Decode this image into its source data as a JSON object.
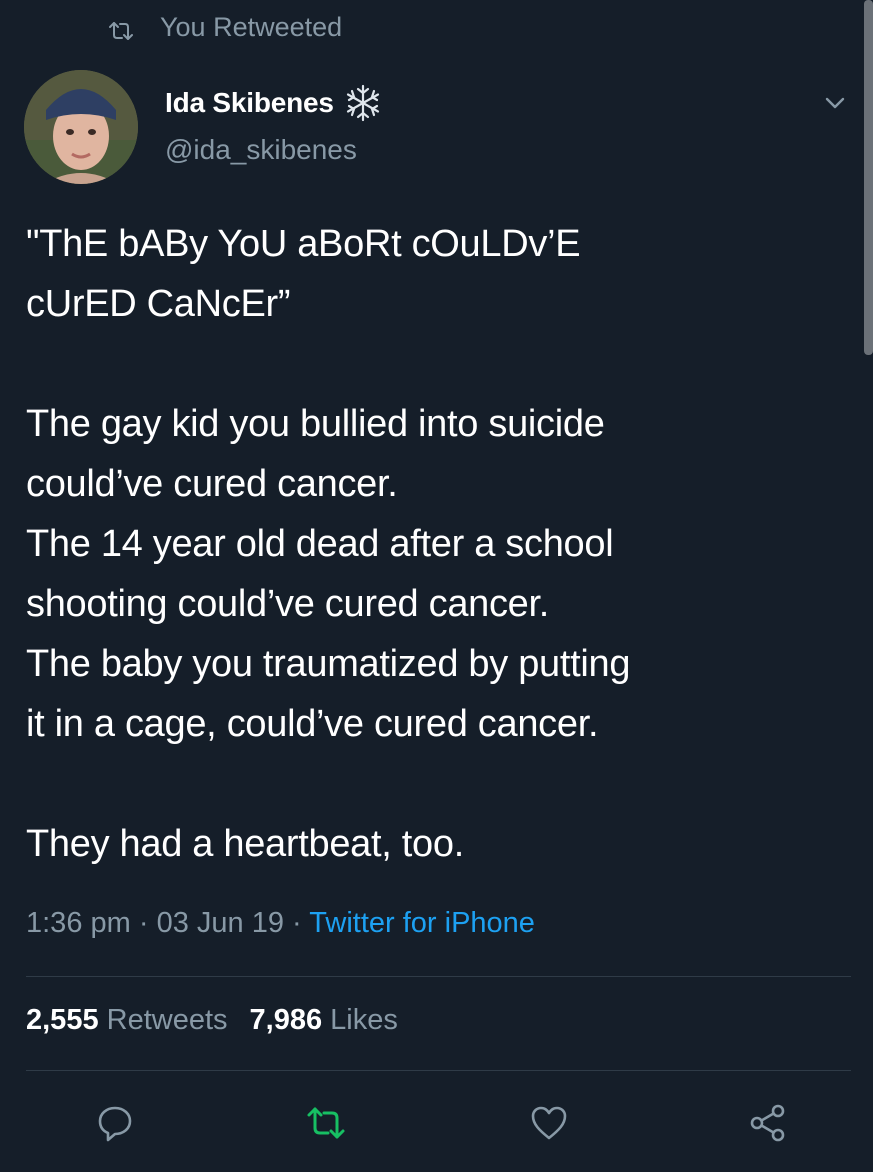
{
  "retweet_context": {
    "label": "You Retweeted"
  },
  "author": {
    "display_name": "Ida Skibenes",
    "handle": "@ida_skibenes"
  },
  "tweet": {
    "text": "\"ThE bABy YoU aBoRt cOuLDv’E\ncUrED CaNcEr”\n\nThe gay kid you bullied into suicide\ncould’ve cured cancer.\nThe 14 year old dead after a school\nshooting could’ve cured cancer.\nThe baby you traumatized by putting\nit in a cage, could’ve cured cancer.\n\nThey had a heartbeat, too.",
    "time": "1:36 pm",
    "separator": "·",
    "date": "03 Jun 19",
    "source": "Twitter for iPhone"
  },
  "stats": {
    "retweets_count": "2,555",
    "retweets_label": "Retweets",
    "likes_count": "7,986",
    "likes_label": "Likes"
  },
  "icons": {
    "retweet_context": "retweet-icon",
    "verified_like": "snowflake-icon",
    "menu": "chevron-down-icon",
    "reply": "reply-icon",
    "retweet": "retweet-icon",
    "like": "heart-icon",
    "share": "share-icon"
  },
  "colors": {
    "background": "#151e29",
    "secondary_text": "#8899a6",
    "link": "#1da1f2",
    "retweeted_active": "#17bf63"
  }
}
